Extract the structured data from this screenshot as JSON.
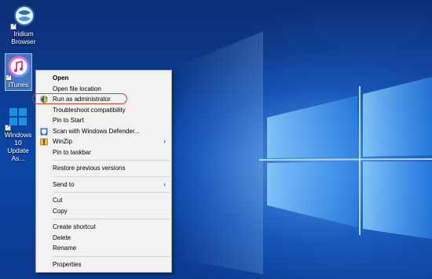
{
  "desktop": {
    "icons": [
      {
        "label_line1": "Iridium",
        "label_line2": "Browser"
      },
      {
        "label_line1": "iTunes",
        "label_line2": ""
      },
      {
        "label_line1": "Windows 10",
        "label_line2": "Update As..."
      }
    ]
  },
  "context_menu": {
    "open": "Open",
    "open_file_location": "Open file location",
    "run_as_administrator": "Run as administrator",
    "troubleshoot_compatibility": "Troubleshoot compatibility",
    "pin_to_start": "Pin to Start",
    "scan_with_defender": "Scan with Windows Defender...",
    "winzip": "WinZip",
    "pin_to_taskbar": "Pin to taskbar",
    "restore_previous_versions": "Restore previous versions",
    "send_to": "Send to",
    "cut": "Cut",
    "copy": "Copy",
    "create_shortcut": "Create shortcut",
    "delete": "Delete",
    "rename": "Rename",
    "properties": "Properties",
    "submenu_arrow": "›"
  },
  "colors": {
    "highlight_ring": "#d2421c",
    "wallpaper": "#0d46a8"
  }
}
